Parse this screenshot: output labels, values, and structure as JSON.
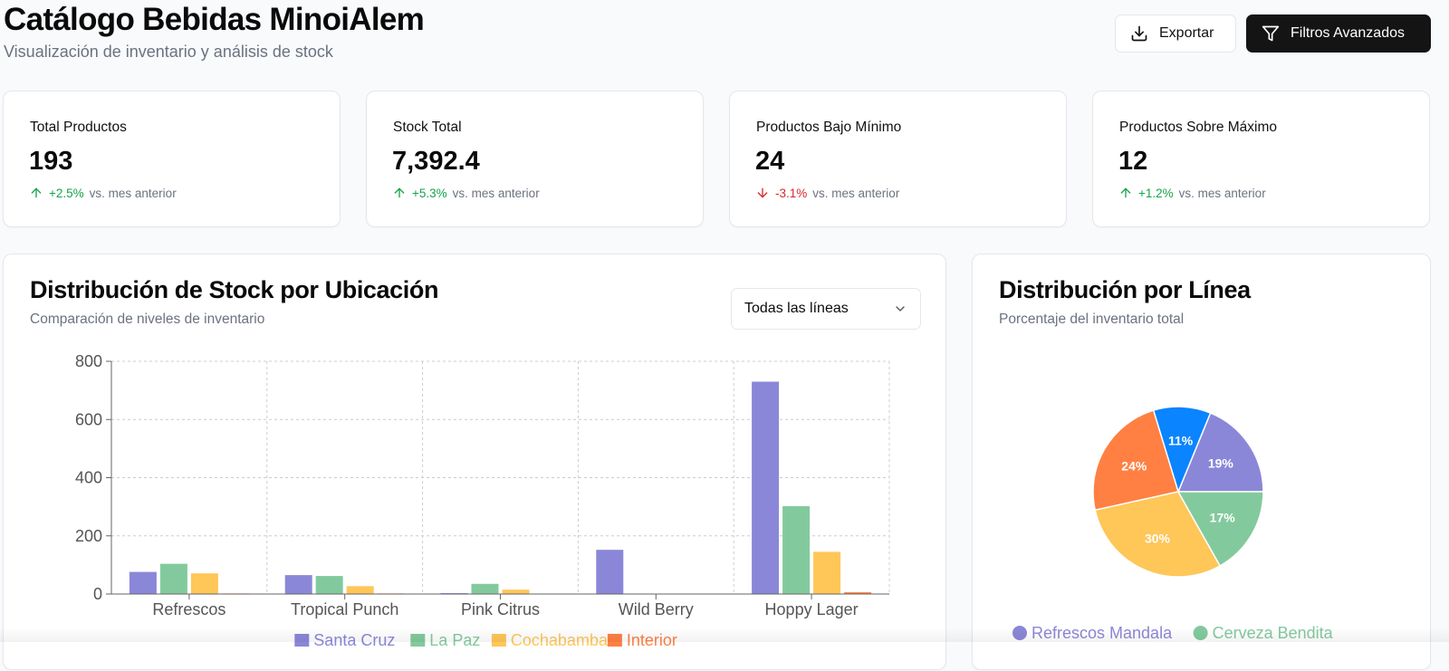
{
  "header": {
    "title": "Catálogo Bebidas MinoiAlem",
    "subtitle": "Visualización de inventario y análisis de stock",
    "export_label": "Exportar",
    "filters_label": "Filtros Avanzados"
  },
  "stats": [
    {
      "label": "Total Productos",
      "value": "193",
      "change": "+2.5%",
      "direction": "up",
      "note": "vs. mes anterior"
    },
    {
      "label": "Stock Total",
      "value": "7,392.4",
      "change": "+5.3%",
      "direction": "up",
      "note": "vs. mes anterior"
    },
    {
      "label": "Productos Bajo Mínimo",
      "value": "24",
      "change": "-3.1%",
      "direction": "down",
      "note": "vs. mes anterior"
    },
    {
      "label": "Productos Sobre Máximo",
      "value": "12",
      "change": "+1.2%",
      "direction": "up",
      "note": "vs. mes anterior"
    }
  ],
  "stock_chart": {
    "title": "Distribución de Stock por Ubicación",
    "subtitle": "Comparación de niveles de inventario",
    "filter_value": "Todas las líneas"
  },
  "pie_panel": {
    "title": "Distribución por Línea",
    "subtitle": "Porcentaje del inventario total"
  },
  "colors": {
    "positive": "#16a34a",
    "negative": "#dc2626"
  },
  "chart_data": [
    {
      "type": "bar",
      "categories": [
        "Refrescos",
        "Tropical Punch",
        "Pink Citrus",
        "Wild Berry",
        "Hoppy Lager"
      ],
      "series": [
        {
          "name": "Santa Cruz",
          "color": "#8b87d8",
          "values": [
            76,
            65,
            3,
            152,
            730
          ]
        },
        {
          "name": "La Paz",
          "color": "#82ca9d",
          "values": [
            104,
            62,
            35,
            0,
            302
          ]
        },
        {
          "name": "Cochabamba",
          "color": "#ffc658",
          "values": [
            71,
            27,
            15,
            0,
            145
          ]
        },
        {
          "name": "Interior",
          "color": "#ff7f45",
          "values": [
            2,
            2,
            0,
            0,
            6
          ]
        }
      ],
      "yticks": [
        "0",
        "200",
        "400",
        "600",
        "800"
      ],
      "ylim": [
        0,
        800
      ],
      "grid": true,
      "legend": "bottom"
    },
    {
      "type": "pie",
      "labels": [
        "Refrescos Mandala",
        "Cerveza Bendita"
      ],
      "slices": [
        {
          "label": "19%",
          "value": 19,
          "color": "#8b87d8"
        },
        {
          "label": "11%",
          "value": 11,
          "color": "#0a84ff"
        },
        {
          "label": "24%",
          "value": 24,
          "color": "#ff8042"
        },
        {
          "label": "30%",
          "value": 30,
          "color": "#ffc658"
        },
        {
          "label": "17%",
          "value": 17,
          "color": "#82ca9d"
        }
      ],
      "legend": [
        {
          "name": "Refrescos Mandala",
          "color": "#8b87d8"
        },
        {
          "name": "Cerveza Bendita",
          "color": "#82ca9d"
        }
      ]
    }
  ]
}
